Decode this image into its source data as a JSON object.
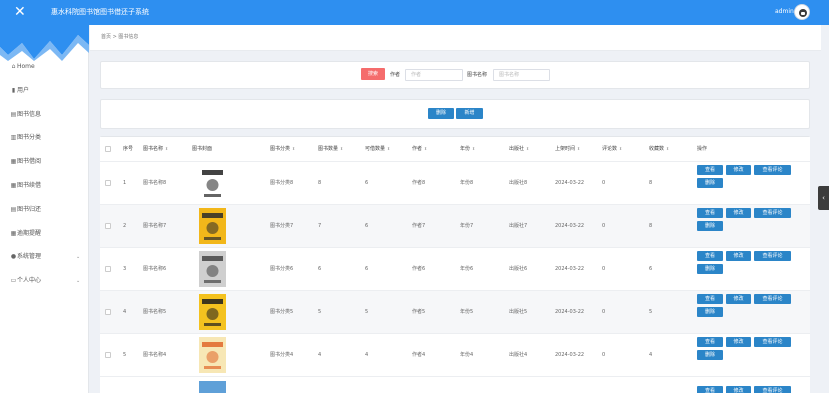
{
  "header": {
    "title": "惠水科院图书馆图书借还子系统",
    "user": "admin"
  },
  "sidebar": {
    "items": [
      {
        "label": "Home",
        "icon": "home-icon",
        "glyph": "⌂"
      },
      {
        "label": "用户",
        "icon": "user-icon",
        "glyph": "▮"
      },
      {
        "label": "图书信息",
        "icon": "book-info-icon",
        "glyph": "▤"
      },
      {
        "label": "图书分类",
        "icon": "category-icon",
        "glyph": "▥"
      },
      {
        "label": "图书借阅",
        "icon": "borrow-icon",
        "glyph": "▦"
      },
      {
        "label": "图书续借",
        "icon": "renew-icon",
        "glyph": "▦"
      },
      {
        "label": "图书归还",
        "icon": "return-icon",
        "glyph": "▤"
      },
      {
        "label": "逾期提醒",
        "icon": "overdue-icon",
        "glyph": "▦"
      },
      {
        "label": "系统管理",
        "icon": "system-icon",
        "glyph": "●"
      },
      {
        "label": "个人中心",
        "icon": "profile-icon",
        "glyph": "▭"
      }
    ],
    "expand_arrow": "⌄"
  },
  "breadcrumb": {
    "home": "首页",
    "sep": ">",
    "current": "图书信息"
  },
  "search": {
    "button": "搜索",
    "author_label": "作者",
    "author_placeholder": "作者",
    "name_label": "图书名称",
    "name_placeholder": "图书名称"
  },
  "actions": {
    "delete": "删除",
    "add": "新增"
  },
  "table": {
    "columns": [
      "序号",
      "图书名称",
      "图书封面",
      "图书分类",
      "图书数量",
      "可借数量",
      "作者",
      "年份",
      "出版社",
      "上架时间",
      "评论数",
      "收藏数",
      "操作"
    ],
    "sortable": [
      false,
      true,
      false,
      true,
      true,
      true,
      true,
      true,
      true,
      true,
      true,
      true,
      false
    ],
    "sort_glyph": "⬍",
    "op_labels": {
      "view": "查看",
      "edit": "修改",
      "comments": "查看评论",
      "delete": "删除"
    },
    "rows": [
      {
        "index": "1",
        "name": "图书名称8",
        "category": "图书分类8",
        "quantity": "8",
        "available": "6",
        "author": "作者8",
        "year": "年份8",
        "publisher": "出版社8",
        "date": "2024-03-22",
        "comments": "0",
        "favorites": "8",
        "cover_color": "#ffffff",
        "cover_accent": "#222222"
      },
      {
        "index": "2",
        "name": "图书名称7",
        "category": "图书分类7",
        "quantity": "7",
        "available": "6",
        "author": "作者7",
        "year": "年份7",
        "publisher": "出版社7",
        "date": "2024-03-22",
        "comments": "0",
        "favorites": "8",
        "cover_color": "#f2b71a",
        "cover_accent": "#2b2b2b"
      },
      {
        "index": "3",
        "name": "图书名称6",
        "category": "图书分类6",
        "quantity": "6",
        "available": "6",
        "author": "作者6",
        "year": "年份6",
        "publisher": "出版社6",
        "date": "2024-03-22",
        "comments": "0",
        "favorites": "6",
        "cover_color": "#cfcfcf",
        "cover_accent": "#444444"
      },
      {
        "index": "4",
        "name": "图书名称5",
        "category": "图书分类5",
        "quantity": "5",
        "available": "5",
        "author": "作者5",
        "year": "年份5",
        "publisher": "出版社5",
        "date": "2024-03-22",
        "comments": "0",
        "favorites": "5",
        "cover_color": "#f4c21f",
        "cover_accent": "#1f1f1f"
      },
      {
        "index": "5",
        "name": "图书名称4",
        "category": "图书分类4",
        "quantity": "4",
        "available": "4",
        "author": "作者4",
        "year": "年份4",
        "publisher": "出版社4",
        "date": "2024-03-22",
        "comments": "0",
        "favorites": "4",
        "cover_color": "#f7e7b5",
        "cover_accent": "#e0662a"
      }
    ],
    "partial_row_cover_color": "#5fa0d8"
  },
  "colors": {
    "topbar": "#2e8ff0",
    "primary_button": "#2b85c8",
    "danger_button": "#f56c6c"
  },
  "scroll_tab_glyph": "‹"
}
